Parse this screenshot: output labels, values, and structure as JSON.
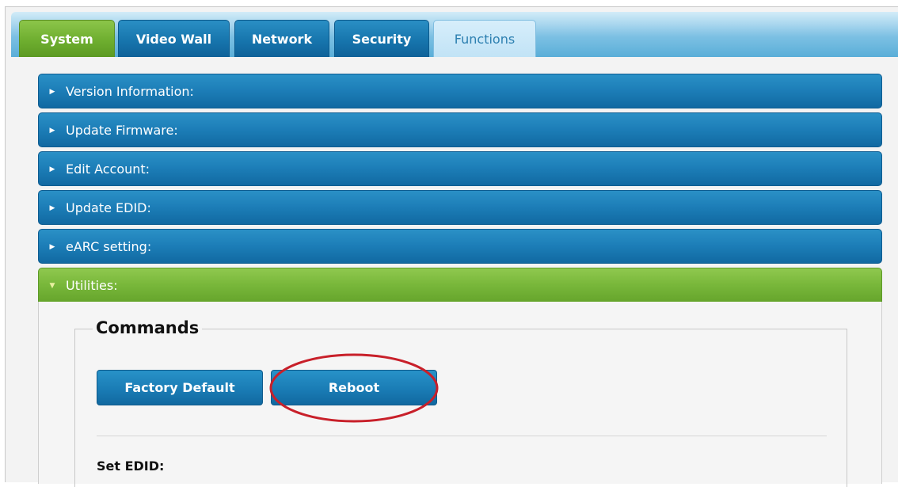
{
  "tabs": [
    {
      "label": "System",
      "state": "active"
    },
    {
      "label": "Video Wall",
      "state": "default"
    },
    {
      "label": "Network",
      "state": "default"
    },
    {
      "label": "Security",
      "state": "default"
    },
    {
      "label": "Functions",
      "state": "light"
    }
  ],
  "sections": [
    {
      "label": "Version Information:",
      "expanded": false
    },
    {
      "label": "Update Firmware:",
      "expanded": false
    },
    {
      "label": "Edit Account:",
      "expanded": false
    },
    {
      "label": "Update EDID:",
      "expanded": false
    },
    {
      "label": "eARC setting:",
      "expanded": false
    },
    {
      "label": "Utilities:",
      "expanded": true
    }
  ],
  "utilities": {
    "commands_legend": "Commands",
    "factory_default_label": "Factory Default",
    "reboot_label": "Reboot",
    "set_edid_label": "Set EDID:"
  },
  "icons": {
    "collapsed": "triangle-right",
    "expanded": "triangle-down"
  },
  "colors": {
    "active_green": "#6eae2f",
    "accent_blue": "#1c7db7",
    "annotation_red": "#c8202a"
  }
}
